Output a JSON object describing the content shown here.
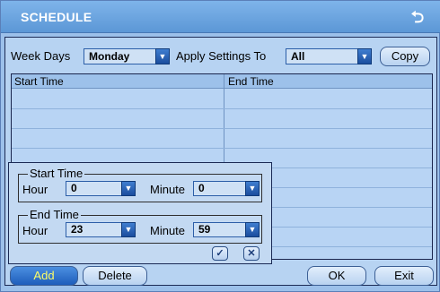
{
  "window": {
    "title": "SCHEDULE",
    "back_icon": "back-arrow-icon"
  },
  "controls": {
    "week_days_label": "Week Days",
    "week_days_value": "Monday",
    "apply_label": "Apply Settings To",
    "apply_value": "All",
    "copy_label": "Copy"
  },
  "table": {
    "columns": [
      "Start Time",
      "End Time"
    ],
    "rows": []
  },
  "popup": {
    "start": {
      "legend": "Start Time",
      "hour_label": "Hour",
      "hour_value": "0",
      "minute_label": "Minute",
      "minute_value": "0"
    },
    "end": {
      "legend": "End Time",
      "hour_label": "Hour",
      "hour_value": "23",
      "minute_label": "Minute",
      "minute_value": "59"
    },
    "confirm_icon": "checkmark-icon",
    "cancel_icon": "close-icon"
  },
  "footer": {
    "add_label": "Add",
    "delete_label": "Delete",
    "ok_label": "OK",
    "exit_label": "Exit"
  },
  "colors": {
    "title_bar": "#6aa4e0",
    "panel": "#b7d3f2",
    "accent_text": "#ffff66"
  }
}
